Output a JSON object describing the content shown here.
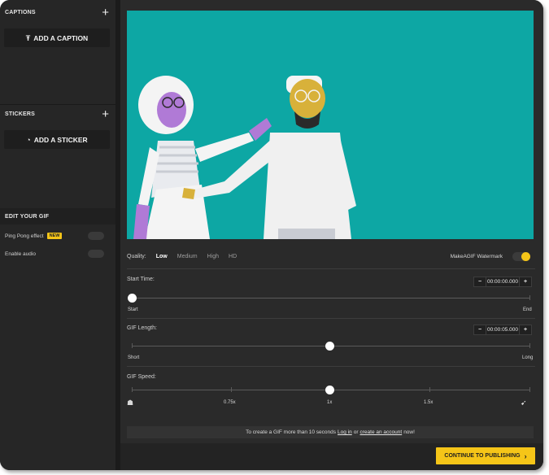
{
  "sidebar": {
    "captions": {
      "title": "CAPTIONS",
      "add_icon": "plus-icon",
      "button_label": "ADD A CAPTION",
      "button_icon": "text-icon"
    },
    "stickers": {
      "title": "STICKERS",
      "add_icon": "plus-icon",
      "button_label": "ADD A STICKER",
      "button_icon": "sticker-icon"
    },
    "edit": {
      "title": "EDIT YOUR GIF",
      "options": [
        {
          "label": "Ping Pong effect",
          "badge": "NEW",
          "enabled": false
        },
        {
          "label": "Enable audio",
          "badge": "",
          "enabled": false
        }
      ]
    }
  },
  "quality": {
    "label": "Quality:",
    "options": [
      "Low",
      "Medium",
      "High",
      "HD"
    ],
    "selected": "Low",
    "watermark_label": "MakeAGIF Watermark",
    "watermark_on": true
  },
  "start_time": {
    "label": "Start Time:",
    "value": "00:00:00.000",
    "min_label": "Start",
    "max_label": "End",
    "position": 0.0
  },
  "gif_length": {
    "label": "GIF Length:",
    "value": "00:00:05.000",
    "min_label": "Short",
    "max_label": "Long",
    "position": 0.5
  },
  "gif_speed": {
    "label": "GIF Speed:",
    "ticks": [
      "0.75x",
      "1x",
      "1.5x"
    ],
    "min_icon": "turtle-icon",
    "max_icon": "rabbit-icon",
    "selected": "1x"
  },
  "info": {
    "prefix": "To create a GIF more than 10 seconds",
    "login": "Log in",
    "or": "or",
    "create": "create an account",
    "suffix": "now!"
  },
  "continue_label": "CONTINUE TO PUBLISHING",
  "colors": {
    "accent": "#f5c518",
    "preview_bg": "#0da7a4",
    "sidebar_bg": "#262626",
    "main_bg": "#2a2a2a"
  }
}
